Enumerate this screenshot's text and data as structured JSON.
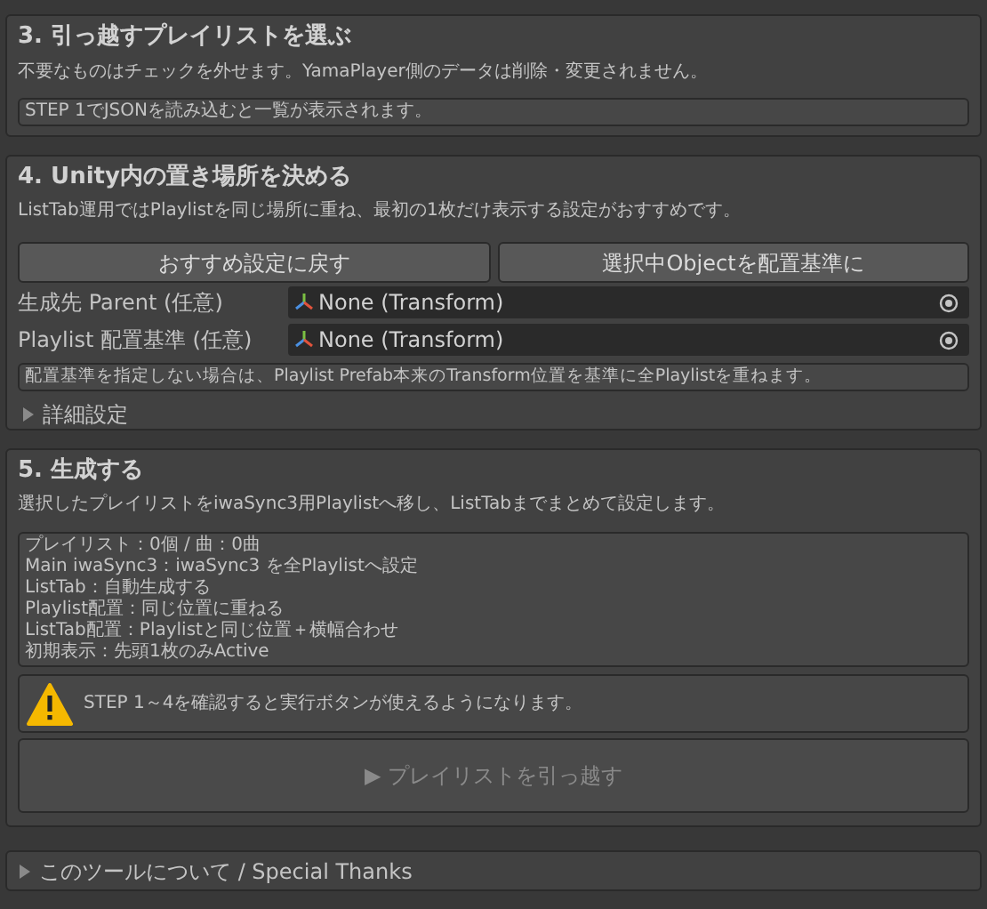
{
  "step3": {
    "title": "3. 引っ越すプレイリストを選ぶ",
    "description": "不要なものはチェックを外せます。YamaPlayer側のデータは削除・変更されません。",
    "help_box": "STEP 1でJSONを読み込むと一覧が表示されます。"
  },
  "step4": {
    "title": "4. Unity内の置き場所を決める",
    "description": "ListTab運用ではPlaylistを同じ場所に重ね、最初の1枚だけ表示する設定がおすすめです。",
    "buttons": [
      "おすすめ設定に戻す",
      "選択中Objectを配置基準に"
    ],
    "fields": [
      {
        "label": "生成先 Parent (任意)",
        "value": "None (Transform)"
      },
      {
        "label": "Playlist 配置基準 (任意)",
        "value": "None (Transform)"
      }
    ],
    "help_box": "配置基準を指定しない場合は、Playlist Prefab本来のTransform位置を基準に全Playlistを重ねます。",
    "foldout": {
      "label": "詳細設定",
      "expanded": false
    }
  },
  "step5": {
    "title": "5. 生成する",
    "description": "選択したプレイリストをiwaSync3用Playlistへ移し、ListTabまでまとめて設定します。",
    "summary_lines": [
      "プレイリスト：0個 / 曲：0曲",
      "Main iwaSync3：iwaSync3 を全Playlistへ設定",
      "ListTab：自動生成する",
      "Playlist配置：同じ位置に重ねる",
      "ListTab配置：Playlistと同じ位置＋横幅合わせ",
      "初期表示：先頭1枚のみActive"
    ],
    "warning": "STEP 1～4を確認すると実行ボタンが使えるようになります。",
    "run_button": {
      "label": "▶ プレイリストを引っ越す",
      "disabled": true
    }
  },
  "about_foldout": {
    "label": "このツールについて / Special Thanks",
    "expanded": false
  }
}
